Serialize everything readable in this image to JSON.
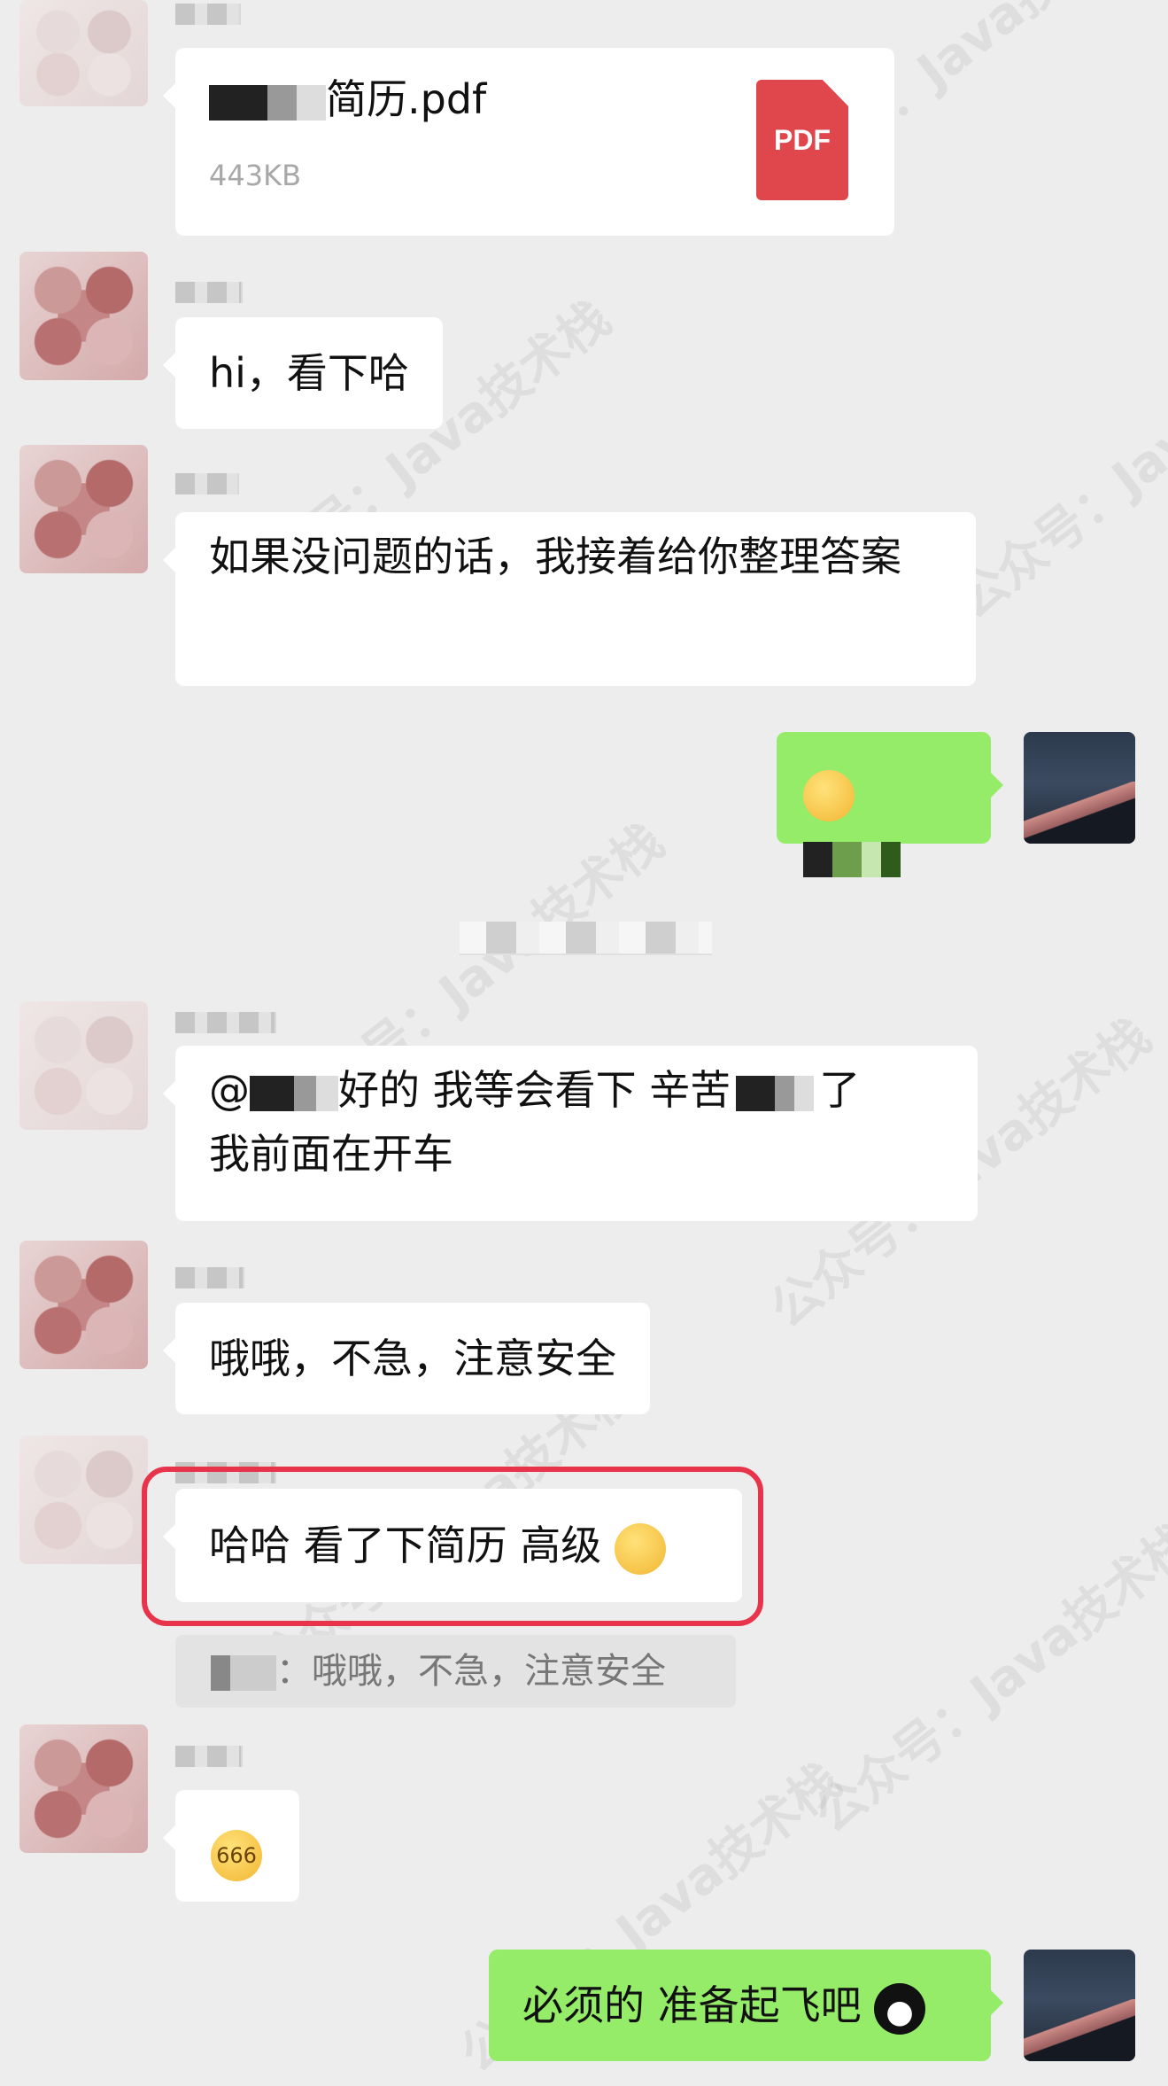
{
  "messages": {
    "file": {
      "name": "简历.pdf",
      "size": "443KB",
      "icon_label": "PDF"
    },
    "m1": "hi，看下哈",
    "m2": "如果没问题的话，我接着给你整理答案",
    "m4_prefix": "@",
    "m4_line1": "好的 我等会看下 辛苦",
    "m4_line1_end": "了",
    "m4_line2": "我前面在开车",
    "m5": "哦哦，不急，注意安全",
    "m6": "哈哈 看了下简历 高级",
    "quote": "：哦哦，不急，注意安全",
    "m8": "必须的 准备起飞吧"
  },
  "emoji": {
    "m6_emoji": "laughing-face-emoji",
    "m7_emoji": "666-thinking-emoji",
    "m8_emoji": "qq-penguin-emoji",
    "m3_emoji": "blushing-face-emoji",
    "m7_label": "666"
  },
  "watermark": {
    "text": "公众号：Java技术栈"
  },
  "colors": {
    "chat_bg": "#ededed",
    "bubble_incoming": "#ffffff",
    "bubble_outgoing": "#95ec69",
    "highlight_border": "#e8344a",
    "pdf_red": "#e0474c"
  }
}
